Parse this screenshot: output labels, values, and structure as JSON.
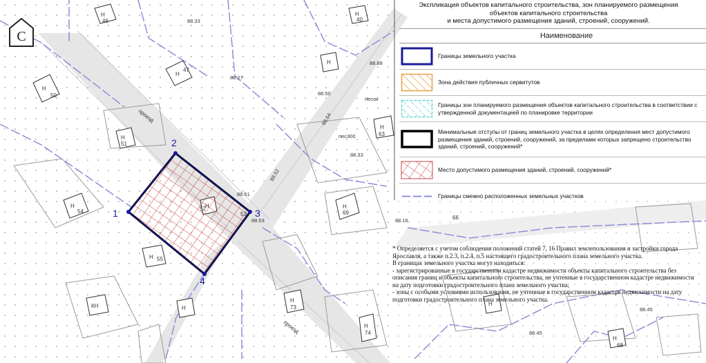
{
  "compass": {
    "letter": "С"
  },
  "map": {
    "point_labels": [
      "1",
      "2",
      "3",
      "4"
    ],
    "building_labels": [
      "Н",
      "Н",
      "Н",
      "Н",
      "Н",
      "Н",
      "Н",
      "Н",
      "Н",
      "Н",
      "Н",
      "Н",
      "Н",
      "Н",
      "КН",
      "Н",
      "Н"
    ],
    "building_numbers": [
      "46",
      "40",
      "47",
      "50",
      "51",
      "54",
      "55",
      "52",
      "53",
      "69",
      "73",
      "74",
      "66",
      "68",
      "63"
    ],
    "street_labels": [
      "проезд",
      "проезд"
    ],
    "elevations": [
      "88.33",
      "88.27",
      "88.50",
      "88.51",
      "88.52",
      "88.53",
      "88.54",
      "88.16",
      "88.45",
      "88.45",
      "88.33",
      "88.88"
    ],
    "misc_labels": [
      "песок",
      "пес300"
    ]
  },
  "legend": {
    "title": "Экспликация объектов капитального строительства, зон планируемого размещения\nобъектов капитального строительства\nи места допустимого размещения зданий, строений, сооружений.",
    "header": "Наименование",
    "items": [
      {
        "label": "Границы земельного участка",
        "swatch": "plot-boundary"
      },
      {
        "label": "Зона действия публичных сервитутов",
        "swatch": "servitude"
      },
      {
        "label": "Границы зон планируемого размещения объектов капитального строительства в соответствии с утвержденной документацией по планировке территории",
        "swatch": "planned-zone"
      },
      {
        "label": "Минимальные отступы от границ земельного участка в целях определения мест допустимого размещения зданий, строений, сооружений, за пределами которых запрещено строительство зданий, строений, сооружений*",
        "swatch": "setback"
      },
      {
        "label": "Место допустимого размещения зданий, строений, сооружений*",
        "swatch": "building-area"
      },
      {
        "label": "Границы смежно расположенных земельных участков",
        "swatch": "adjacent"
      }
    ],
    "note": "* Определяется с учетом соблюдения положений статей 7, 16 Правил землепользования и застройки города Ярославля, а также п.2.3, п.2.4, п.5 настоящего градостроительного плана земельного участка.\nВ границах земельного участка могут находиться:\n- зарегистрированные в государственном кадастре недвижимости объекты капитального строительства без описания границ и объекты капитального строительства, не учтенные в государственном кадастре недвижимости на дату подготовки градостроительного плана земельного участка;\n- зоны с особыми условиями использования, не учтенные в государственном кадастре недвижимости на дату подготовки градостроительного плана земельного участка."
  },
  "colors": {
    "plot_boundary": "#1a1a9c",
    "hatch": "#c8474a",
    "servitude": "#e5a24a",
    "planned": "#69d6d6",
    "adjacent": "#8d8ed8",
    "road": "#e6e6e6"
  }
}
